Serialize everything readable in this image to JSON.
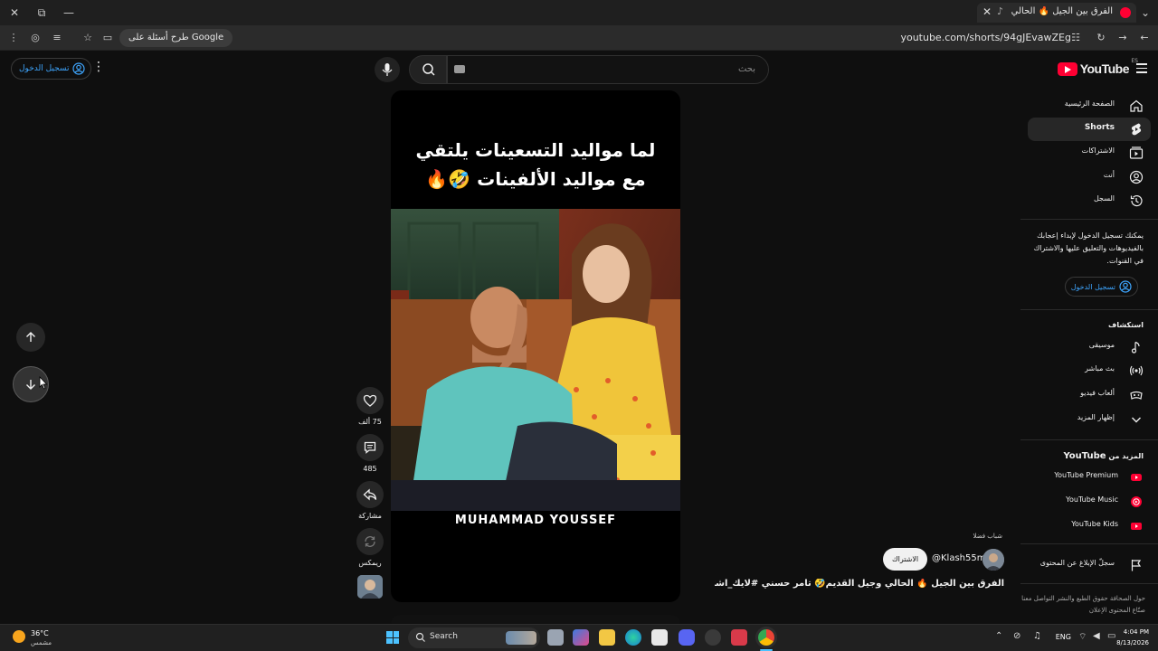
{
  "browser": {
    "tab_title": "الفرق بين الجيل 🔥 الحالي وجيل القديم",
    "tab_close": "✕",
    "new_tab": "+",
    "url": "youtube.com/shorts/94gJEvawZEg",
    "google_pill": "طرح أسئلة على Google",
    "window_close": "✕",
    "window_restore": "⧉",
    "window_min": "—"
  },
  "header": {
    "logo_text": "YouTube",
    "logo_country": "ES",
    "search_placeholder": "بحث",
    "sign_in": "تسجيل الدخول"
  },
  "sidebar": {
    "items": [
      {
        "label": "الصفحة الرئيسية",
        "icon": "home-icon"
      },
      {
        "label": "Shorts",
        "icon": "shorts-icon"
      },
      {
        "label": "الاشتراكات",
        "icon": "subscriptions-icon"
      },
      {
        "label": "أنت",
        "icon": "you-icon"
      },
      {
        "label": "السجل",
        "icon": "history-icon"
      }
    ],
    "signin_note": "يمكنك تسجيل الدخول لإبداء إعجابك بالفيديوهات والتعليق عليها والاشتراك في القنوات.",
    "signin_button": "تسجيل الدخول",
    "explore_title": "استكشاف",
    "explore": [
      {
        "label": "موسيقى",
        "icon": "music-icon"
      },
      {
        "label": "بث مباشر",
        "icon": "live-icon"
      },
      {
        "label": "ألعاب فيديو",
        "icon": "gaming-icon"
      },
      {
        "label": "إظهار المزيد",
        "icon": "chevron-down-icon"
      }
    ],
    "more_title_prefix": "المزيد من",
    "more_title_brand": "YouTube",
    "more": [
      {
        "label": "YouTube Premium"
      },
      {
        "label": "YouTube Music"
      },
      {
        "label": "YouTube Kids"
      }
    ],
    "report": "سجلّ الإبلاغ عن المحتوى",
    "footer": "حول  الصحافة  حقوق الطبع والنشر  التواصل معنا  صنّاع المحتوى  الإعلان"
  },
  "short": {
    "caption_line1": "لما مواليد التسعينات يلتقي",
    "caption_line2": "مع مواليد الألفينات 🤣🔥",
    "watermark": "MUHAMMAD YOUSSEF",
    "likes": "75 ألف",
    "comments": "485",
    "share": "مشاركة",
    "remix": "ريمكس",
    "suggested_label": "شباب فضلا",
    "channel": "@Klash55m",
    "subscribe": "الاشتراك",
    "title": "الفرق بين الجيل 🔥 الحالي وجيل القديم🤣 تامر حسني #لايك_اشتراك ..."
  },
  "taskbar": {
    "temp": "36°C",
    "condition": "مشمس",
    "search": "Search",
    "lang": "ENG",
    "time": "4:04 PM",
    "date": "8/13/2026"
  },
  "colors": {
    "accent": "#3ea6ff",
    "brand_red": "#ff0033",
    "background": "#0f0f0f"
  }
}
